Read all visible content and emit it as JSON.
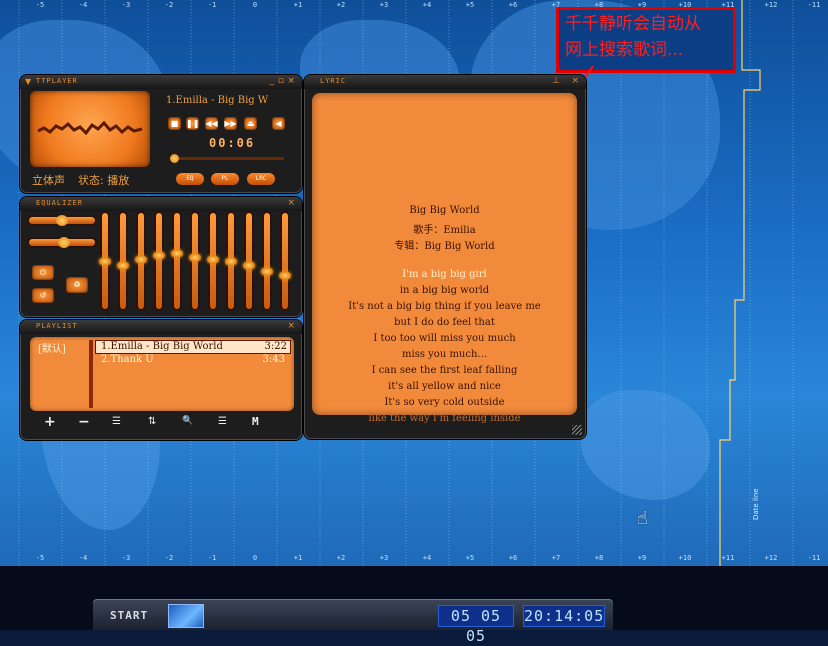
{
  "callout": {
    "line1": "千千静听会自动从",
    "line2": "网上搜索歌词..."
  },
  "timezones_top": [
    "-5",
    "-4",
    "-3",
    "-2",
    "-1",
    "0",
    "+1",
    "+2",
    "+3",
    "+4",
    "+5",
    "+6",
    "+7",
    "+8",
    "+9",
    "+10",
    "+11",
    "+12",
    "-11"
  ],
  "timezones_bottom": [
    "-5",
    "-4",
    "-3",
    "-2",
    "-1",
    "0",
    "+1",
    "+2",
    "+3",
    "+4",
    "+5",
    "+6",
    "+7",
    "+8",
    "+9",
    "+10",
    "+11",
    "+12",
    "-11"
  ],
  "dateline_label": "Date line",
  "player": {
    "title": "TTPLAYER",
    "track_scroll": "1.Emilla - Big Big W",
    "time": "00:06",
    "status_channel": "立体声",
    "status_state": "状态: 播放",
    "btn_eq": "EQ",
    "btn_pl": "PL",
    "btn_lrc": "LRC"
  },
  "equalizer": {
    "title": "EQUALIZER"
  },
  "playlist": {
    "title": "PLAYLIST",
    "category": "[默认]",
    "items": [
      {
        "name": "1.Emilla - Big Big World",
        "duration": "3:22"
      },
      {
        "name": "2.Thank U",
        "duration": "3:43"
      }
    ],
    "toolbar": [
      "+",
      "−",
      "☰",
      "⇅",
      "🔍",
      "☰",
      "M"
    ]
  },
  "lyric": {
    "title": "LYRIC",
    "lines": [
      "Big Big World",
      "歌手：Emilia",
      "专辑：Big Big World",
      "",
      "I'm a big big girl",
      "in a big big world",
      "It's not a big big thing if you leave me",
      "but I do do feel that",
      "I too too will miss you much",
      "miss you much...",
      "I can see the first leaf falling",
      "it's all yellow and nice",
      "It's so very cold outside",
      "like the way I'm feeling inside"
    ]
  },
  "taskbar": {
    "start": "START",
    "date": "05 05 05",
    "time": "20:14:05"
  },
  "colors": {
    "accent": "#f07a1f",
    "callout_red": "#ff2020",
    "screen_orange": "#f28a3c"
  }
}
